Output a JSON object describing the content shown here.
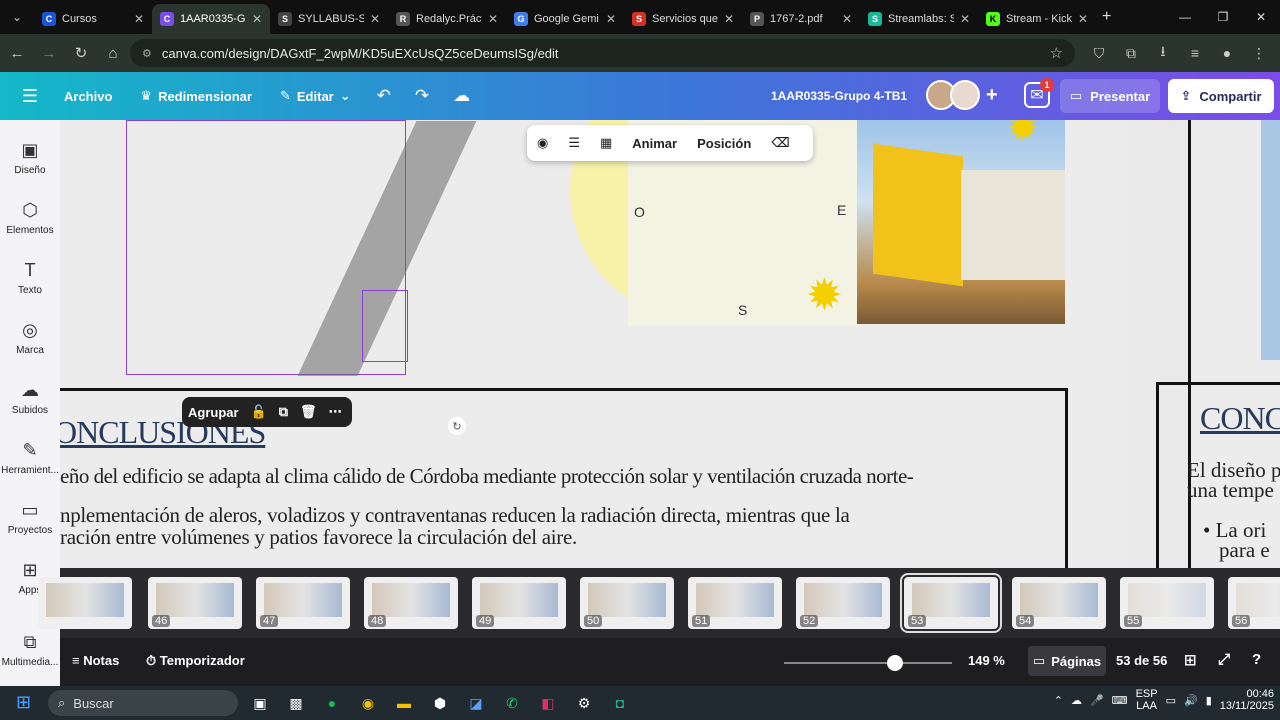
{
  "browser": {
    "tabs": [
      {
        "title": "Cursos",
        "color": "#1a56d6",
        "icon": "C"
      },
      {
        "title": "1AAR0335-G",
        "color": "#7a4de6",
        "icon": "C",
        "active": true
      },
      {
        "title": "SYLLABUS-S",
        "color": "#444444",
        "icon": "S"
      },
      {
        "title": "Redalyc.Práct",
        "color": "#555555",
        "icon": "R"
      },
      {
        "title": "Google Gemi",
        "color": "#3f7ee8",
        "icon": "G"
      },
      {
        "title": "Servicios que",
        "color": "#d93025",
        "icon": "S"
      },
      {
        "title": "1767-2.pdf",
        "color": "#555555",
        "icon": "P"
      },
      {
        "title": "Streamlabs: S",
        "color": "#18b99a",
        "icon": "S"
      },
      {
        "title": "Stream - Kick",
        "color": "#53fc18",
        "icon": "K"
      }
    ],
    "url": "canva.com/design/DAGxtF_2wpM/KD5uEXcUsQZ5ceDeumsISg/edit"
  },
  "canva": {
    "menu": {
      "archivo": "Archivo",
      "redimensionar": "Redimensionar",
      "editar": "Editar"
    },
    "doc_title": "1AAR0335-Grupo 4-TB1",
    "comments_badge": "1",
    "present_label": "Presentar",
    "share_label": "Compartir"
  },
  "sidebar": {
    "items": [
      {
        "label": "Diseño",
        "icon": "design-icon"
      },
      {
        "label": "Elementos",
        "icon": "elements-icon"
      },
      {
        "label": "Texto",
        "icon": "text-icon"
      },
      {
        "label": "Marca",
        "icon": "brand-icon"
      },
      {
        "label": "Subidos",
        "icon": "uploads-icon"
      },
      {
        "label": "Herramient...",
        "icon": "tools-icon"
      },
      {
        "label": "Proyectos",
        "icon": "projects-icon"
      },
      {
        "label": "Apps",
        "icon": "apps-icon"
      },
      {
        "label": "Multimedia...",
        "icon": "media-icon"
      }
    ]
  },
  "floating_toolbar": {
    "animate": "Animar",
    "position": "Posición"
  },
  "context_toolbar": {
    "group": "Agrupar"
  },
  "compass": {
    "west": "O",
    "east": "E",
    "south": "S"
  },
  "slide": {
    "title": "ONCLUSIONES",
    "paragraph1": "eño del edificio se adapta al clima cálido de Córdoba mediante protección solar y ventilación cruzada norte-",
    "paragraph2_line1": "nplementación de aleros, voladizos y contraventanas reducen la radiación directa, mientras que la",
    "paragraph2_line2": "ración entre volúmenes y patios favorece la circulación del aire."
  },
  "next_slide": {
    "title": "CONC",
    "line1": "El diseño p",
    "line2": "una tempe",
    "bullet1": "La ori",
    "bullet2": "para e"
  },
  "thumbnails": [
    "46",
    "47",
    "48",
    "49",
    "50",
    "51",
    "52",
    "53",
    "54",
    "55",
    "56"
  ],
  "bottom_bar": {
    "notes": "Notas",
    "timer": "Temporizador",
    "zoom": "149 %",
    "pages": "Páginas",
    "page_count": "53 de 56"
  },
  "taskbar": {
    "search": "Buscar",
    "lang": "ESP",
    "region": "LAA",
    "time": "00:46",
    "date": "13/11/2025"
  }
}
